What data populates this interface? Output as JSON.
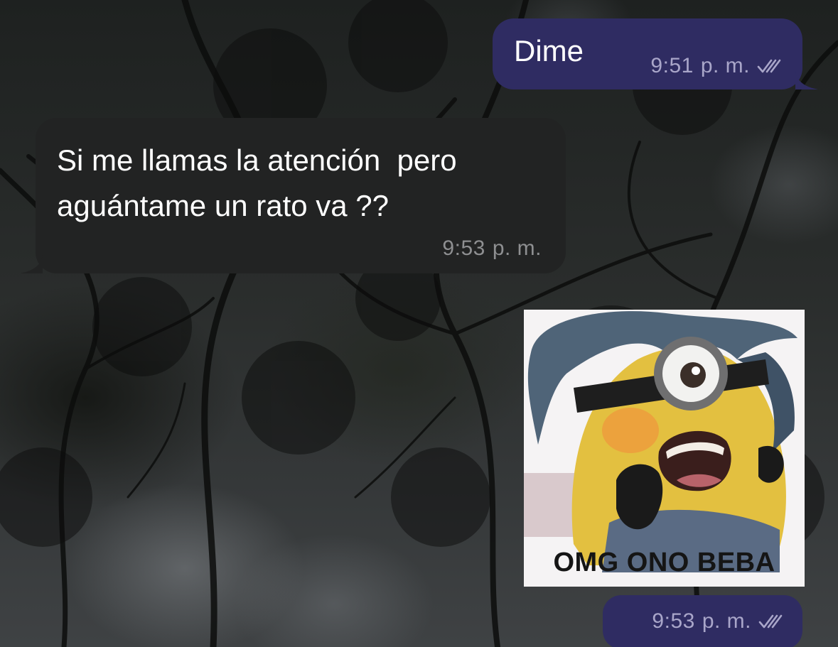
{
  "chat": {
    "messages": [
      {
        "direction": "outgoing",
        "text": "Dime",
        "time": "9:51",
        "period": "p. m.",
        "status_icon": "double-check-icon"
      },
      {
        "direction": "incoming",
        "text": "Si me llamas la atención  pero aguántame un rato va ??",
        "time": "9:53",
        "period": "p. m."
      },
      {
        "direction": "outgoing",
        "type": "sticker",
        "sticker_caption": "OMG ONO BEBA",
        "time": "9:53",
        "period": "p. m.",
        "status_icon": "double-check-icon"
      }
    ]
  },
  "colors": {
    "outgoing_bubble": "#2f2c62",
    "incoming_bubble": "#222323",
    "outgoing_meta": "#a9a6c9",
    "incoming_meta": "#8e8f91"
  }
}
